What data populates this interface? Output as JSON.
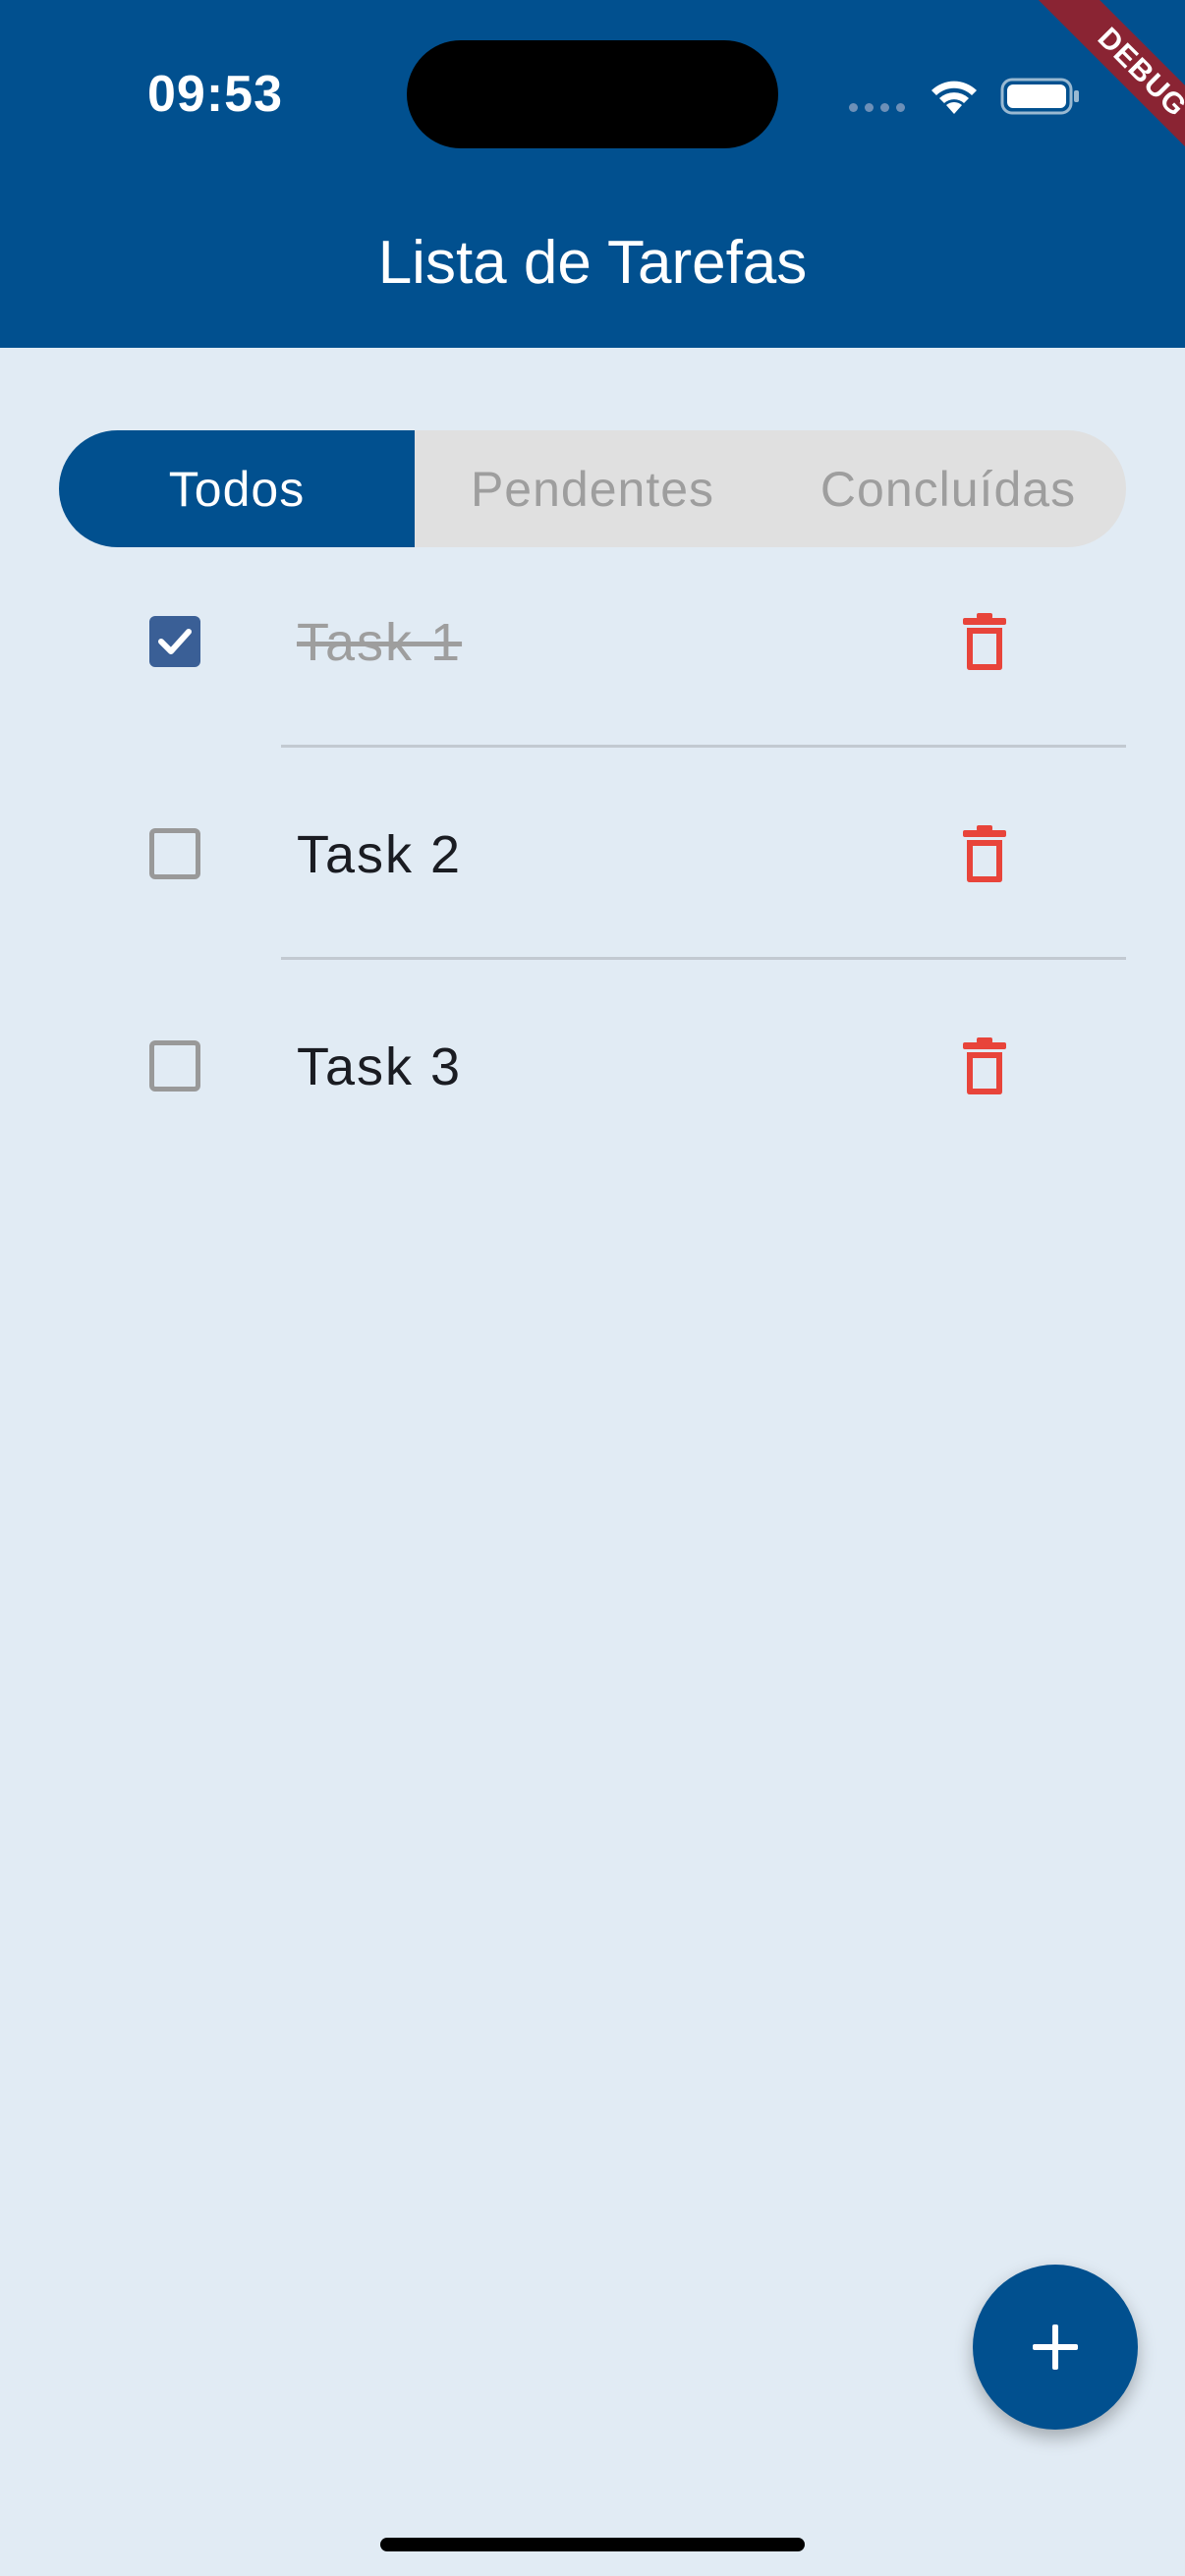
{
  "status_bar": {
    "time": "09:53"
  },
  "debug_banner": "DEBUG",
  "header": {
    "title": "Lista de Tarefas"
  },
  "filter_tabs": [
    {
      "label": "Todos",
      "selected": true
    },
    {
      "label": "Pendentes",
      "selected": false
    },
    {
      "label": "Concluídas",
      "selected": false
    }
  ],
  "tasks": [
    {
      "title": "Task 1",
      "completed": true
    },
    {
      "title": "Task 2",
      "completed": false
    },
    {
      "title": "Task 3",
      "completed": false
    }
  ],
  "icons": {
    "checkbox_checked": "check-icon",
    "delete": "trash-icon",
    "fab": "plus-icon"
  },
  "colors": {
    "primary": "#01508f",
    "background": "#e1ebf4",
    "delete": "#e8443a",
    "checkbox_checked": "#3a5f96",
    "debug_banner": "#8a2433"
  }
}
